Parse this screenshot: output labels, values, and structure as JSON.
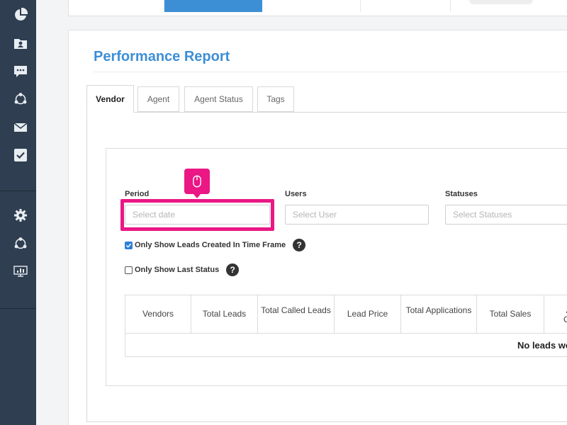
{
  "page": {
    "title": "Performance Report"
  },
  "sidebar": {
    "icons": [
      "pie-chart-icon",
      "user-folder-icon",
      "chat-icon",
      "network-icon",
      "mail-icon",
      "checkbox-icon",
      "gear-icon",
      "network-icon",
      "monitor-chart-icon"
    ]
  },
  "tabs": [
    {
      "label": "Vendor",
      "active": true
    },
    {
      "label": "Agent",
      "active": false
    },
    {
      "label": "Agent Status",
      "active": false
    },
    {
      "label": "Tags",
      "active": false
    }
  ],
  "filters": {
    "period_label": "Period",
    "period_placeholder": "Select date",
    "users_label": "Users",
    "users_placeholder": "Select User",
    "statuses_label": "Statuses",
    "statuses_placeholder": "Select Statuses"
  },
  "options": {
    "only_created_label": "Only Show Leads Created In Time Frame",
    "only_created_checked": true,
    "only_last_status_label": "Only Show Last Status",
    "only_last_status_checked": false
  },
  "table": {
    "columns": [
      "Vendors",
      "Total Leads",
      "Total Called Leads",
      "Lead Price",
      "Total Applications",
      "Total Sales",
      "Att Con"
    ],
    "empty_message": "No leads wo"
  },
  "colors": {
    "sidebar": "#2f3e50",
    "accent": "#3d8fd5",
    "highlight": "#ea1785"
  }
}
